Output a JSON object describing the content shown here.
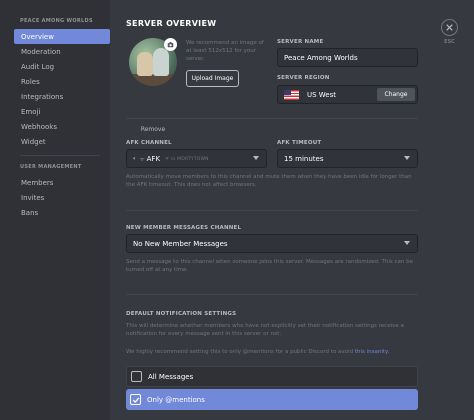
{
  "sidebar": {
    "server_header": "PEACE AMONG WORLDS",
    "items": [
      {
        "label": "Overview"
      },
      {
        "label": "Moderation"
      },
      {
        "label": "Audit Log"
      },
      {
        "label": "Roles"
      },
      {
        "label": "Integrations"
      },
      {
        "label": "Emoji"
      },
      {
        "label": "Webhooks"
      },
      {
        "label": "Widget"
      }
    ],
    "user_header": "USER MANAGEMENT",
    "user_items": [
      {
        "label": "Members"
      },
      {
        "label": "Invites"
      },
      {
        "label": "Bans"
      }
    ]
  },
  "main": {
    "title": "SERVER OVERVIEW",
    "icon_hint": "We recommend an image of at least 512x512 for your server.",
    "upload_label": "Upload Image",
    "remove_label": "Remove",
    "server_name_label": "SERVER NAME",
    "server_name_value": "Peace Among Worlds",
    "region_label": "SERVER REGION",
    "region_value": "US West",
    "change_label": "Change",
    "afk_channel_label": "AFK CHANNEL",
    "afk_channel_name": "AFK",
    "afk_channel_category": "MORTYTOWN",
    "afk_timeout_label": "AFK TIMEOUT",
    "afk_timeout_value": "15 minutes",
    "afk_desc": "Automatically move members to this channel and mute them when they have been idle for longer than the AFK timeout. This does not affect browsers.",
    "new_member_label": "NEW MEMBER MESSAGES CHANNEL",
    "new_member_value": "No New Member Messages",
    "new_member_desc": "Send a message to this channel when someone joins this server. Messages are randomized. This can be turned off at any time.",
    "notif_label": "DEFAULT NOTIFICATION SETTINGS",
    "notif_desc": "This will determine whether members who have not explicitly set their notification settings receive a notification for every message sent in this server or not.",
    "notif_recommend": "We highly recommend setting this to only @mentions for a public Discord to avoid",
    "notif_link": "this insanity.",
    "option_all": "All Messages",
    "option_mentions": "Only @mentions",
    "esc_label": "ESC"
  },
  "colors": {
    "accent": "#7289da",
    "background": "#36393f",
    "sidebar": "#2f3136"
  }
}
